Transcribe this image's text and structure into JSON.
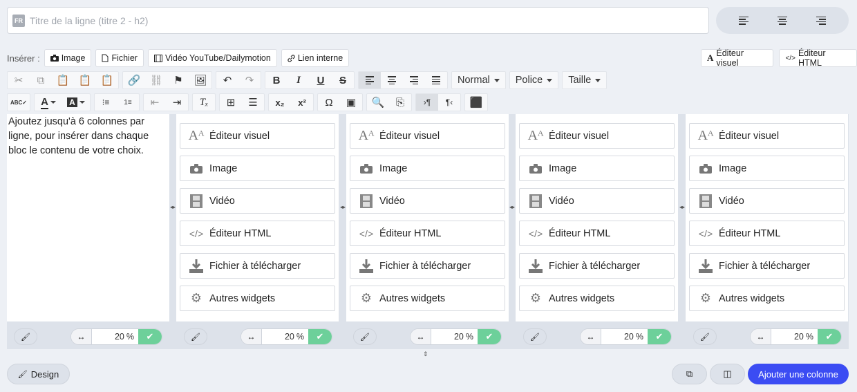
{
  "title_field": {
    "lang": "FR",
    "placeholder": "Titre de la ligne (titre 2 - h2)"
  },
  "insert_bar": {
    "label": "Insérer :",
    "buttons": [
      {
        "icon": "camera-icon",
        "label": "Image"
      },
      {
        "icon": "file-icon",
        "label": "Fichier"
      },
      {
        "icon": "film-icon",
        "label": "Vidéo YouTube/Dailymotion"
      },
      {
        "icon": "link-icon",
        "label": "Lien interne"
      }
    ]
  },
  "editor_switch": {
    "visual": "Éditeur visuel",
    "html": "Éditeur HTML"
  },
  "toolbar": {
    "format": "Normal",
    "font": "Police",
    "size": "Taille"
  },
  "intro_text": "Ajoutez jusqu'à 6 colonnes par ligne, pour insérer dans chaque bloc le contenu de votre choix.",
  "widgets": [
    {
      "icon": "font-size-icon",
      "label": "Éditeur visuel"
    },
    {
      "icon": "camera-icon",
      "label": "Image"
    },
    {
      "icon": "film-icon",
      "label": "Vidéo"
    },
    {
      "icon": "code-icon",
      "label": "Éditeur HTML"
    },
    {
      "icon": "download-icon",
      "label": "Fichier à télécharger"
    },
    {
      "icon": "gears-icon",
      "label": "Autres widgets"
    }
  ],
  "columns": [
    {
      "width": "20",
      "unit": "%"
    },
    {
      "width": "20",
      "unit": "%"
    },
    {
      "width": "20",
      "unit": "%"
    },
    {
      "width": "20",
      "unit": "%"
    },
    {
      "width": "20",
      "unit": "%"
    }
  ],
  "footer": {
    "design": "Design",
    "add_column": "Ajouter une colonne"
  },
  "colors": {
    "accent": "#3b4cf3",
    "ok": "#6dd09a",
    "bg": "#edf0f5"
  }
}
